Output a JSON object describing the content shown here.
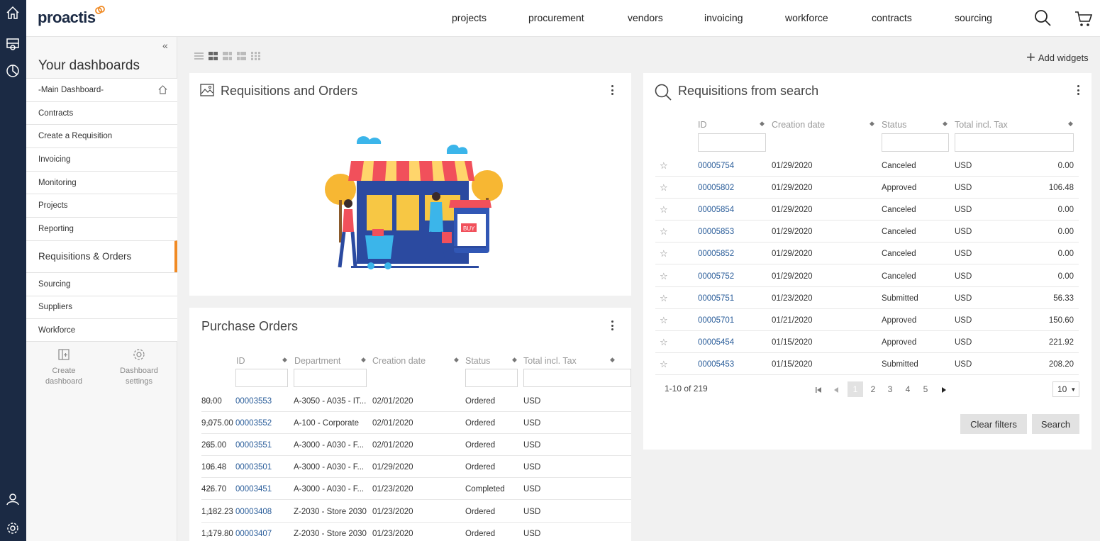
{
  "topbar": {
    "logo": "proactis",
    "nav": [
      "projects",
      "procurement",
      "vendors",
      "invoicing",
      "workforce",
      "contracts",
      "sourcing"
    ]
  },
  "sidebar": {
    "title": "Your dashboards",
    "items": [
      "-Main Dashboard-",
      "Contracts",
      "Create a Requisition",
      "Invoicing",
      "Monitoring",
      "Projects",
      "Reporting",
      "Requisitions & Orders",
      "Sourcing",
      "Suppliers",
      "Workforce"
    ],
    "active_index": 7,
    "create_label": "Create dashboard",
    "settings_label": "Dashboard settings"
  },
  "toolbar": {
    "add_widgets": "Add widgets"
  },
  "widgets": {
    "requisitions_orders": {
      "title": "Requisitions and Orders"
    },
    "purchase_orders": {
      "title": "Purchase Orders",
      "headers": [
        "ID",
        "Department",
        "Creation date",
        "Status",
        "Total incl. Tax"
      ],
      "rows": [
        [
          "00003553",
          "A-3050 - A035 - IT...",
          "02/01/2020",
          "Ordered",
          "USD",
          "80.00"
        ],
        [
          "00003552",
          "A-100 - Corporate",
          "02/01/2020",
          "Ordered",
          "USD",
          "9,075.00"
        ],
        [
          "00003551",
          "A-3000 - A030 - F...",
          "02/01/2020",
          "Ordered",
          "USD",
          "265.00"
        ],
        [
          "00003501",
          "A-3000 - A030 - F...",
          "01/29/2020",
          "Ordered",
          "USD",
          "106.48"
        ],
        [
          "00003451",
          "A-3000 - A030 - F...",
          "01/23/2020",
          "Completed",
          "USD",
          "426.70"
        ],
        [
          "00003408",
          "Z-2030 - Store 2030",
          "01/23/2020",
          "Ordered",
          "USD",
          "1,182.23"
        ],
        [
          "00003407",
          "Z-2030 - Store 2030",
          "01/23/2020",
          "Ordered",
          "USD",
          "1,179.80"
        ]
      ]
    },
    "requisitions_search": {
      "title": "Requisitions from search",
      "headers": [
        "ID",
        "Creation date",
        "Status",
        "Total incl. Tax"
      ],
      "rows": [
        [
          "00005754",
          "01/29/2020",
          "Canceled",
          "USD",
          "0.00"
        ],
        [
          "00005802",
          "01/29/2020",
          "Approved",
          "USD",
          "106.48"
        ],
        [
          "00005854",
          "01/29/2020",
          "Canceled",
          "USD",
          "0.00"
        ],
        [
          "00005853",
          "01/29/2020",
          "Canceled",
          "USD",
          "0.00"
        ],
        [
          "00005852",
          "01/29/2020",
          "Canceled",
          "USD",
          "0.00"
        ],
        [
          "00005752",
          "01/29/2020",
          "Canceled",
          "USD",
          "0.00"
        ],
        [
          "00005751",
          "01/23/2020",
          "Submitted",
          "USD",
          "56.33"
        ],
        [
          "00005701",
          "01/21/2020",
          "Approved",
          "USD",
          "150.60"
        ],
        [
          "00005454",
          "01/15/2020",
          "Approved",
          "USD",
          "221.92"
        ],
        [
          "00005453",
          "01/15/2020",
          "Submitted",
          "USD",
          "208.20"
        ]
      ],
      "range_text": "1-10 of 219",
      "pages": [
        "1",
        "2",
        "3",
        "4",
        "5"
      ],
      "current_page": "1",
      "per_page": "10",
      "clear_label": "Clear filters",
      "search_label": "Search"
    }
  },
  "colors": {
    "rail": "#1b2a44",
    "accent": "#f08a24",
    "link": "#2a5d9a"
  }
}
